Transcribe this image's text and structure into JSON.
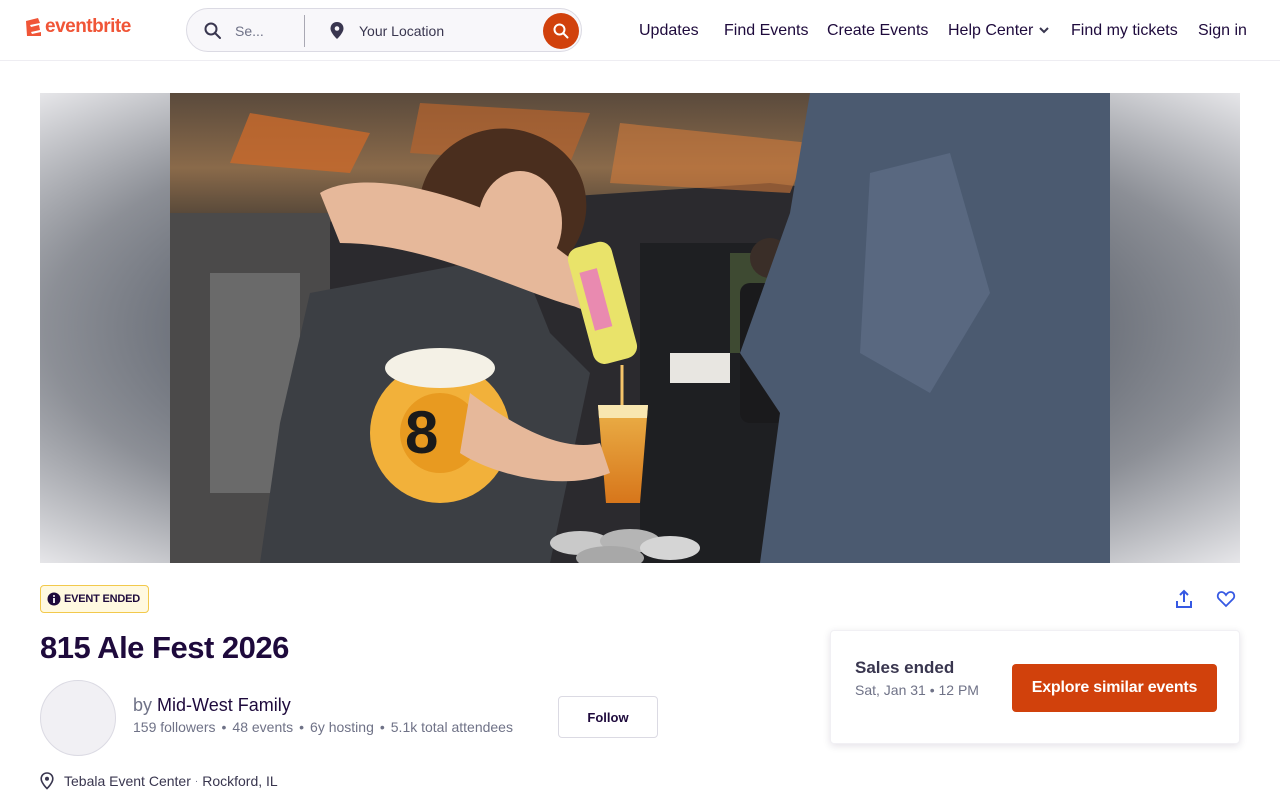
{
  "header": {
    "logo_text": "eventbrite",
    "search_placeholder": "Se...",
    "location_placeholder": "Your Location",
    "nav": [
      "Updates",
      "Find Events",
      "Create Events",
      "Help Center",
      "Find my tickets",
      "Sign in"
    ]
  },
  "event": {
    "status_badge": "EVENT ENDED",
    "title": "815 Ale Fest 2026",
    "organizer_prefix": "by",
    "organizer_name": "Mid-West Family",
    "stats": {
      "followers": "159 followers",
      "events": "48 events",
      "hosting": "6y hosting",
      "attendees": "5.1k total attendees"
    },
    "follow_label": "Follow",
    "venue": "Tebala Event Center",
    "city": "Rockford, IL"
  },
  "sales_card": {
    "title": "Sales ended",
    "date": "Sat, Jan 31 • 12 PM",
    "cta": "Explore similar events"
  },
  "colors": {
    "brand": "#f05537",
    "accent": "#d1410c",
    "text_dark": "#1e0a3c",
    "badge_bg": "#fff9e0"
  },
  "icons": [
    "search-icon",
    "location-pin-icon",
    "chevron-down-icon",
    "info-icon",
    "share-icon",
    "heart-icon"
  ]
}
